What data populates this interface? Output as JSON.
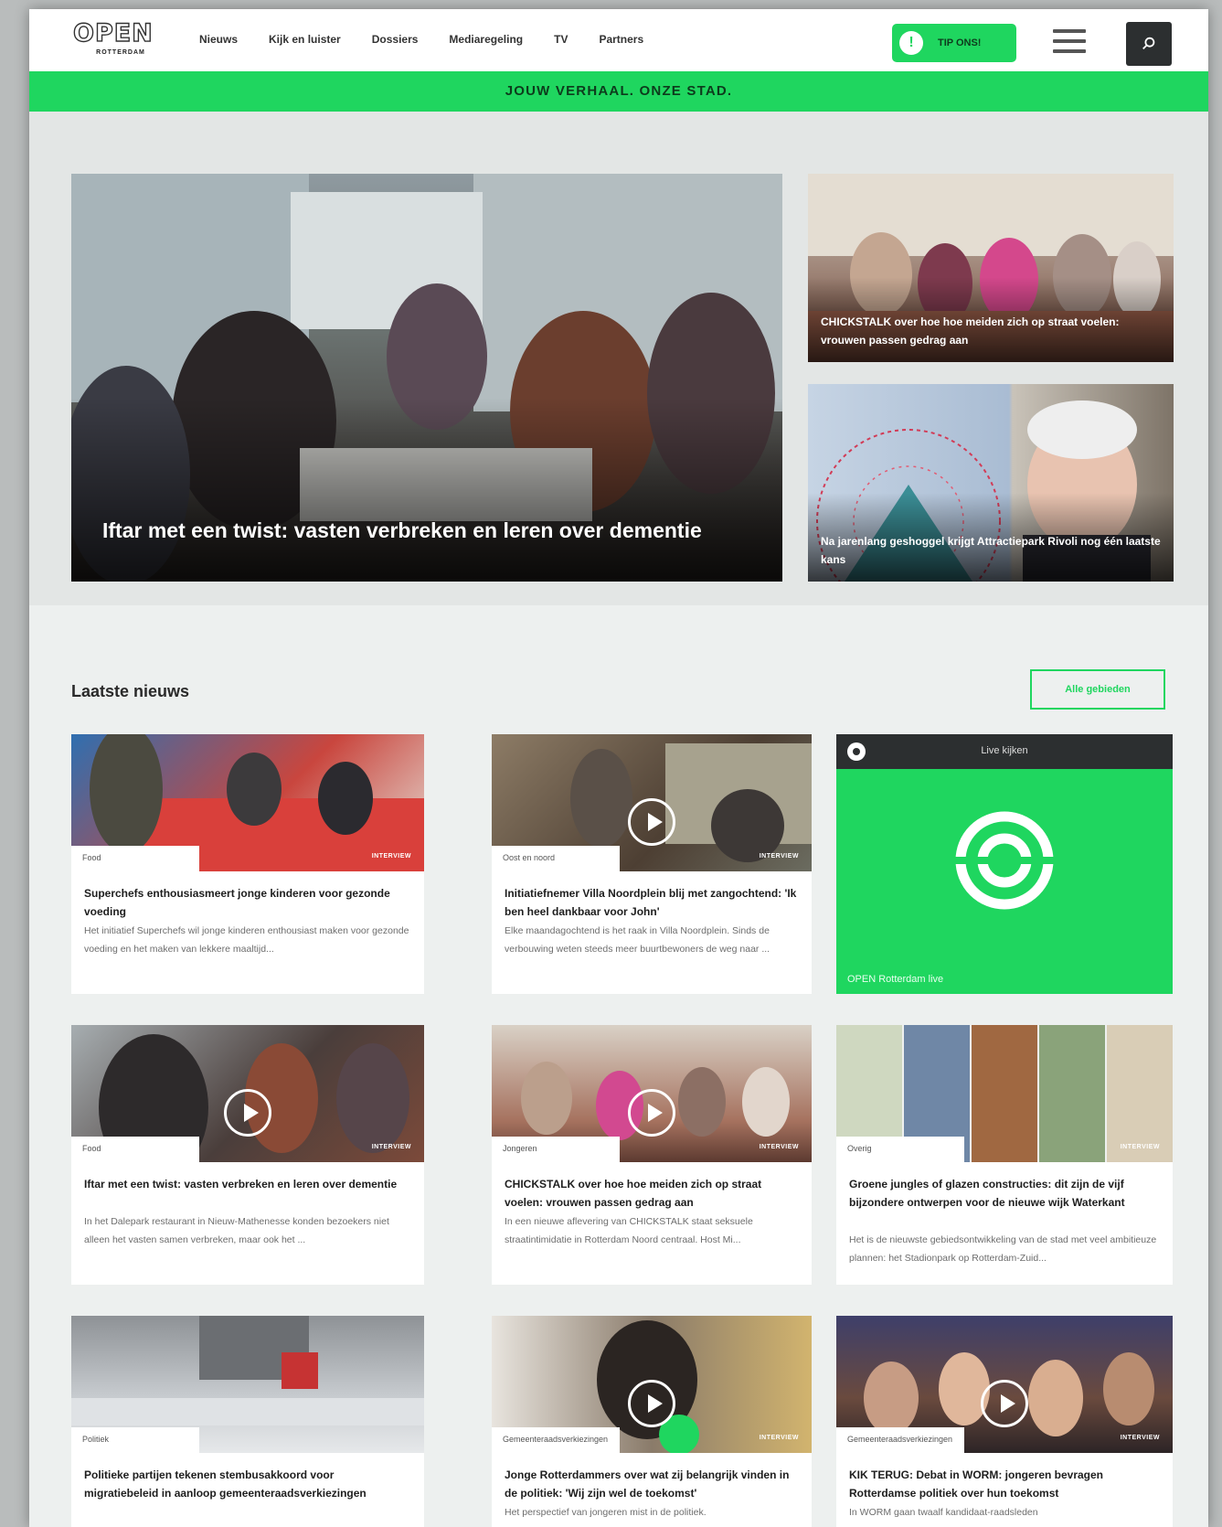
{
  "header": {
    "logo_word": "OPEN",
    "logo_sub": "ROTTERDAM",
    "nav": [
      "Nieuws",
      "Kijk en luister",
      "Dossiers",
      "Mediaregeling",
      "TV",
      "Partners"
    ],
    "tip_label": "TIP ONS!",
    "tip_icon": "!",
    "slogan": "JOUW VERHAAL. ONZE STAD."
  },
  "hero": {
    "main_title": "Iftar met een twist: vasten verbreken en leren over dementie",
    "side1_title": "CHICKSTALK over hoe hoe meiden zich op straat voelen: vrouwen passen gedrag aan",
    "side2_title": "Na jarenlang geshoggel krijgt Attractiepark Rivoli nog één laatste kans"
  },
  "section": {
    "title": "Laatste nieuws",
    "all_button": "Alle gebieden"
  },
  "live": {
    "header": "Live kijken",
    "label": "OPEN Rotterdam live"
  },
  "cards": [
    {
      "cat": "Food",
      "badge": "INTERVIEW",
      "title": "Superchefs enthousiasmeert jonge kinderen voor gezonde voeding",
      "text": "Het initiatief Superchefs wil jonge kinderen enthousiast maken voor gezonde voeding en het maken van lekkere maaltijd..."
    },
    {
      "cat": "Oost en noord",
      "badge": "INTERVIEW",
      "title": "Initiatiefnemer Villa Noordplein blij met zangochtend: 'Ik ben heel dankbaar voor John'",
      "text": "Elke maandagochtend is het raak in Villa Noordplein. Sinds de verbouwing weten steeds meer buurtbewoners de weg naar ..."
    },
    {
      "cat": "Food",
      "badge": "INTERVIEW",
      "title": "Iftar met een twist: vasten verbreken en leren over dementie",
      "text": "In het Dalepark restaurant in Nieuw-Mathenesse konden bezoekers niet alleen het vasten samen verbreken, maar ook het ..."
    },
    {
      "cat": "Jongeren",
      "badge": "INTERVIEW",
      "title": "CHICKSTALK over hoe hoe meiden zich op straat voelen: vrouwen passen gedrag aan",
      "text": "In een nieuwe aflevering van CHICKSTALK staat seksuele straatintimidatie in Rotterdam Noord centraal. Host Mi..."
    },
    {
      "cat": "Overig",
      "badge": "INTERVIEW",
      "title": "Groene jungles of glazen constructies: dit zijn de vijf bijzondere ontwerpen voor de nieuwe wijk Waterkant",
      "text": "Het is de nieuwste gebiedsontwikkeling van de stad met veel ambitieuze plannen: het Stadionpark op Rotterdam-Zuid..."
    },
    {
      "cat": "Politiek",
      "badge": "",
      "title": "Politieke partijen tekenen stembusakkoord voor migratiebeleid in aanloop gemeenteraadsverkiezingen",
      "text": ""
    },
    {
      "cat": "Gemeenteraadsverkiezingen",
      "badge": "INTERVIEW",
      "title": "Jonge Rotterdammers over wat zij belangrijk vinden in de politiek: 'Wij zijn wel de toekomst'",
      "text": "Het perspectief van jongeren mist in de politiek."
    },
    {
      "cat": "Gemeenteraadsverkiezingen",
      "badge": "INTERVIEW",
      "title": "KIK TERUG: Debat in WORM: jongeren bevragen Rotterdamse politiek over hun toekomst",
      "text": "In WORM gaan twaalf kandidaat-raadsleden"
    }
  ],
  "colors": {
    "accent": "#1fd65f",
    "dark": "#2c2f30"
  }
}
